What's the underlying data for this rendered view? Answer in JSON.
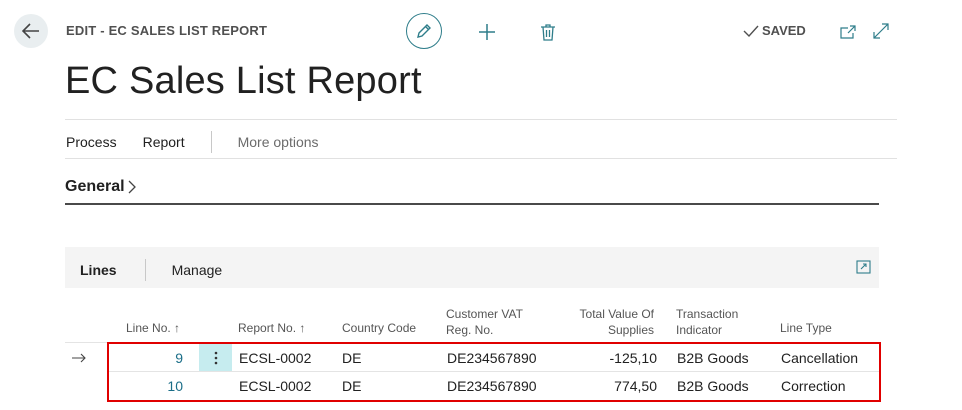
{
  "header": {
    "edit_caption": "EDIT - EC SALES LIST REPORT",
    "saved_label": "SAVED"
  },
  "page": {
    "title": "EC Sales List Report"
  },
  "actions": {
    "process": "Process",
    "report": "Report",
    "more_options": "More options"
  },
  "general": {
    "title": "General"
  },
  "lines": {
    "tab_lines": "Lines",
    "tab_manage": "Manage",
    "columns": {
      "line_no": "Line No. ↑",
      "report_no": "Report No. ↑",
      "country_code": "Country Code",
      "customer_vat_1": "Customer VAT",
      "customer_vat_2": "Reg. No.",
      "total_value_1": "Total Value Of",
      "total_value_2": "Supplies",
      "transaction_1": "Transaction",
      "transaction_2": "Indicator",
      "line_type": "Line Type"
    },
    "rows": [
      {
        "line_no": "9",
        "report_no": "ECSL-0002",
        "country_code": "DE",
        "customer_vat": "DE234567890",
        "total_value": "-125,10",
        "transaction": "B2B Goods",
        "line_type": "Cancellation"
      },
      {
        "line_no": "10",
        "report_no": "ECSL-0002",
        "country_code": "DE",
        "customer_vat": "DE234567890",
        "total_value": "774,50",
        "transaction": "B2B Goods",
        "line_type": "Correction"
      }
    ]
  },
  "colors": {
    "accent": "#1b6e88",
    "highlight": "#e00000",
    "selected_cell": "#c6ecef"
  }
}
